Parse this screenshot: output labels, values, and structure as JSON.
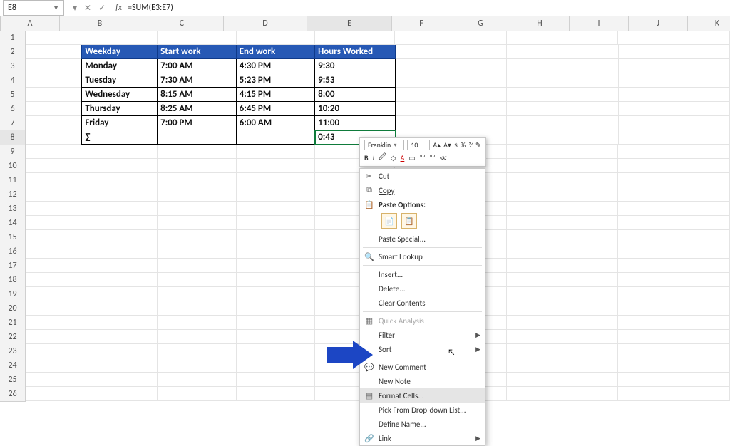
{
  "nameBox": "E8",
  "formula": "=SUM(E3:E7)",
  "fxLabel": "fx",
  "colHeaders": [
    "A",
    "B",
    "C",
    "D",
    "E",
    "F",
    "G",
    "H",
    "I",
    "J",
    "K"
  ],
  "rowCount": 26,
  "activeCol": "E",
  "activeRow": 8,
  "table": {
    "headers": [
      "Weekday",
      "Start work",
      "End work",
      "Hours Worked"
    ],
    "rows": [
      [
        "Monday",
        "7:00 AM",
        "4:30 PM",
        "9:30"
      ],
      [
        "Tuesday",
        "7:30 AM",
        "5:23 PM",
        "9:53"
      ],
      [
        "Wednesday",
        "8:15 AM",
        "4:15 PM",
        "8:00"
      ],
      [
        "Thursday",
        "8:25 AM",
        "6:45 PM",
        "10:20"
      ],
      [
        "Friday",
        "7:00 PM",
        "6:00 AM",
        "11:00"
      ]
    ],
    "sumLabel": "∑",
    "sumValue": "0:43"
  },
  "miniToolbar": {
    "font": "Franklin",
    "size": "10",
    "btns_r1": [
      "A▴",
      "A▾",
      "$",
      "%",
      "⁹⁄",
      "✎"
    ],
    "btns_r2": [
      "B",
      "I",
      "🖉",
      "◇",
      "A",
      "▭",
      "⁰⁰",
      "⁰⁰",
      "≪"
    ]
  },
  "context": {
    "cut": "Cut",
    "copy": "Copy",
    "pasteOptionsLabel": "Paste Options:",
    "pasteSpecial": "Paste Special...",
    "smartLookup": "Smart Lookup",
    "insert": "Insert...",
    "delete": "Delete...",
    "clear": "Clear Contents",
    "quickAnalysis": "Quick Analysis",
    "filter": "Filter",
    "sort": "Sort",
    "newComment": "New Comment",
    "newNote": "New Note",
    "formatCells": "Format Cells...",
    "pickList": "Pick From Drop-down List...",
    "defineName": "Define Name...",
    "link": "Link"
  }
}
